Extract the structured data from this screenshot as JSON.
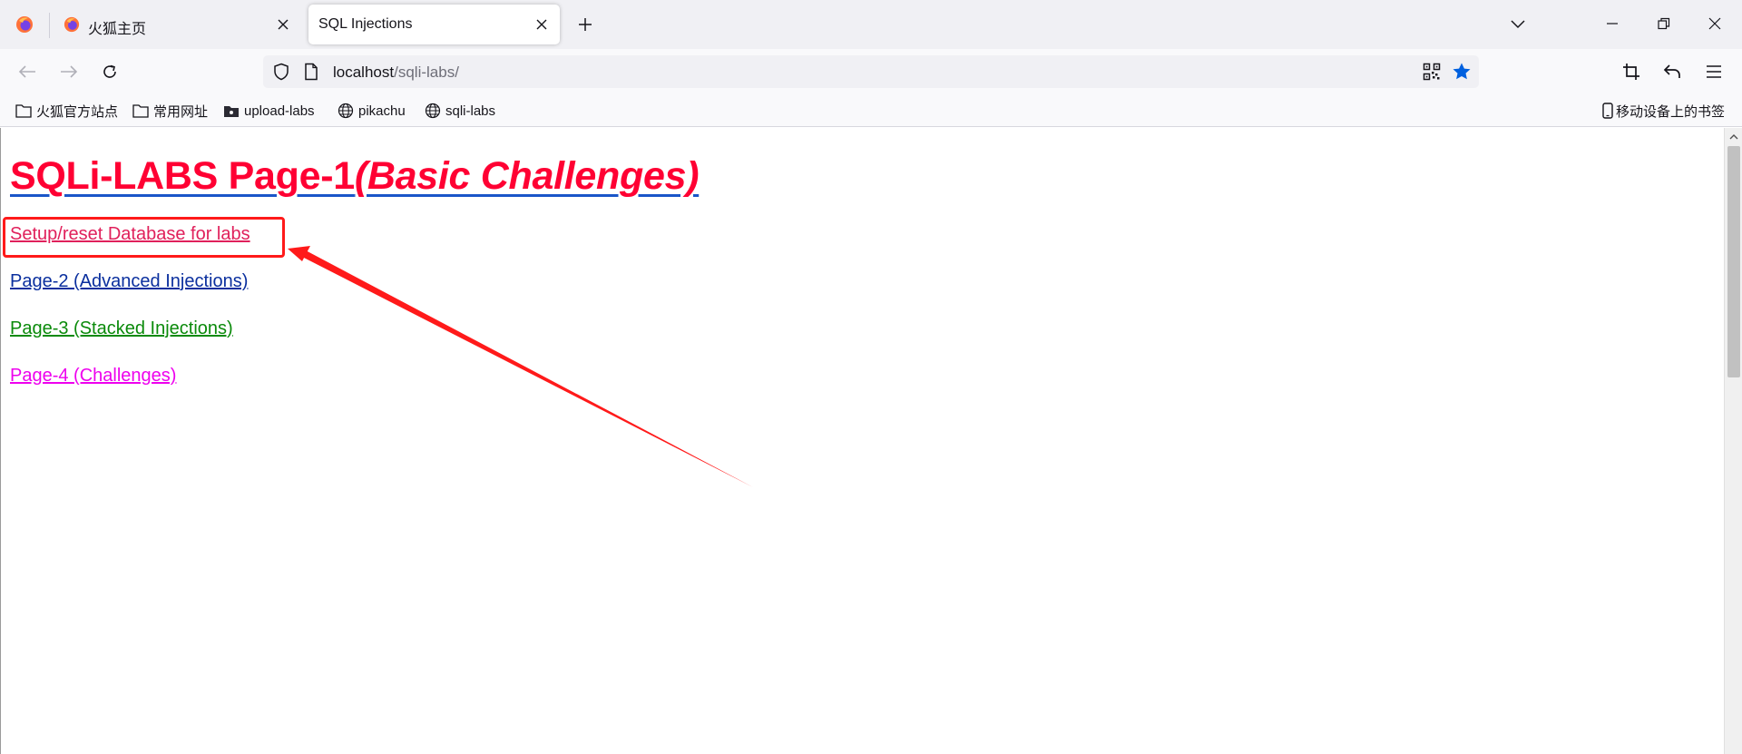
{
  "browser": {
    "tabs": [
      {
        "title": "火狐主页",
        "active": false
      },
      {
        "title": "SQL Injections",
        "active": true
      }
    ],
    "url": {
      "host": "localhost",
      "path": "/sqli-labs/"
    },
    "bookmarks": [
      {
        "label": "火狐官方站点",
        "icon": "folder-icon"
      },
      {
        "label": "常用网址",
        "icon": "folder-icon"
      },
      {
        "label": "upload-labs",
        "icon": "folder-dark-icon"
      },
      {
        "label": "pikachu",
        "icon": "globe-icon"
      },
      {
        "label": "sqli-labs",
        "icon": "globe-icon"
      }
    ],
    "mobile_bookmarks": "移动设备上的书签"
  },
  "page": {
    "heading_main": "SQLi-LABS Page-1",
    "heading_sub": "(Basic Challenges)",
    "links": [
      {
        "label": "Setup/reset Database for labs",
        "color": "#e0205b"
      },
      {
        "label": "Page-2 (Advanced Injections)",
        "color": "#0a2f9e"
      },
      {
        "label": "Page-3 (Stacked Injections)",
        "color": "#0a8a0a"
      },
      {
        "label": "Page-4 (Challenges)",
        "color": "#ee00ee"
      }
    ]
  },
  "colors": {
    "heading": "#ff0033",
    "annotation": "#ff1a1a",
    "star": "#0060df"
  }
}
